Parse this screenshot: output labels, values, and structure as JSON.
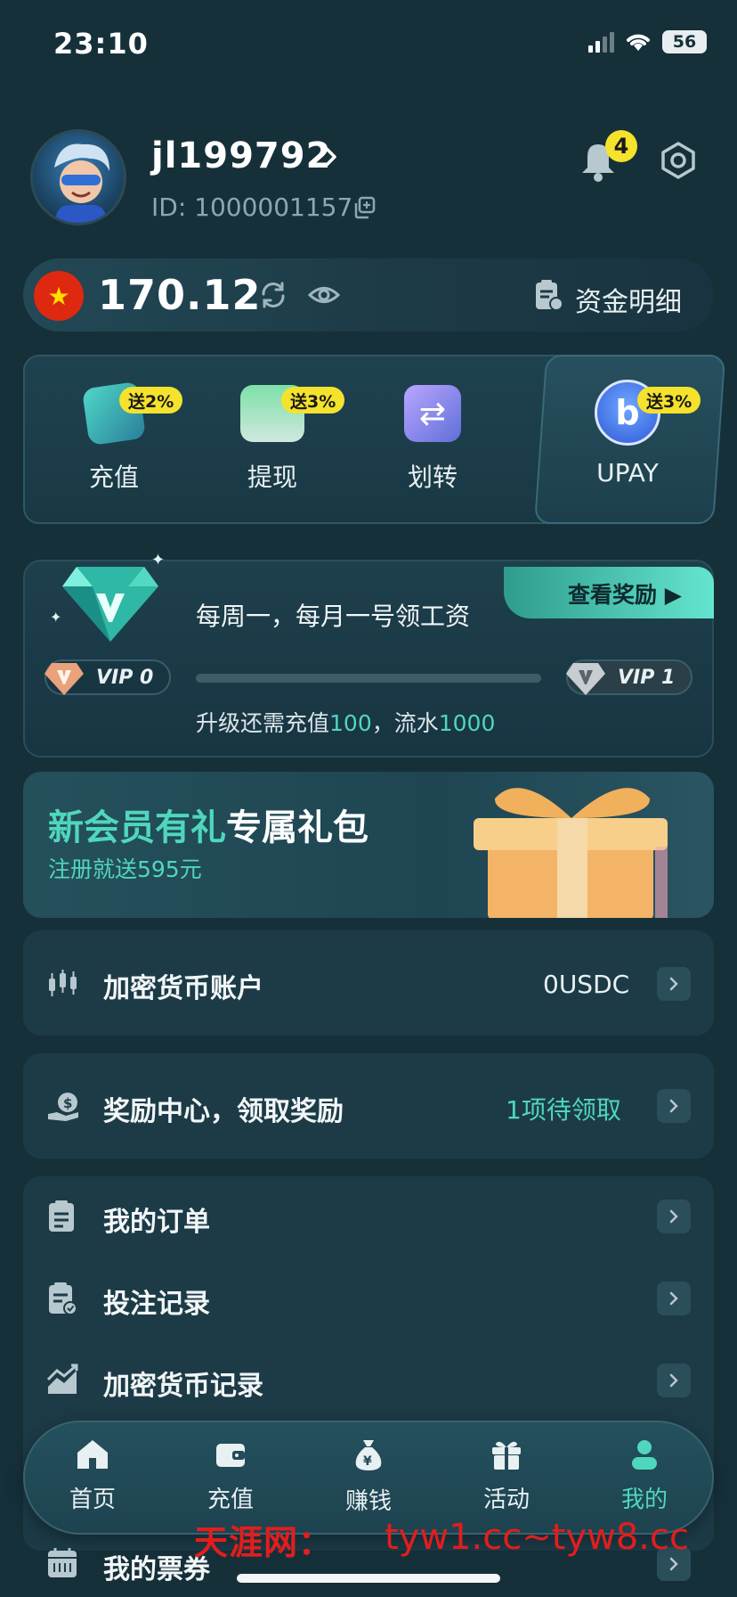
{
  "status_bar": {
    "time": "23:10",
    "battery": "56"
  },
  "profile": {
    "username": "jl199792",
    "id_text": "ID: 1000001157",
    "notification_count": "4"
  },
  "balance": {
    "amount": "170.12",
    "fund_details_label": "资金明细"
  },
  "quick_actions": [
    {
      "label": "充值",
      "tag": "送2%",
      "icon": "deposit-icon"
    },
    {
      "label": "提现",
      "tag": "送3%",
      "icon": "withdraw-icon"
    },
    {
      "label": "划转",
      "tag": "",
      "icon": "transfer-icon"
    },
    {
      "label": "UPAY",
      "tag": "送3%",
      "icon": "upay-icon"
    }
  ],
  "vip": {
    "view_rewards_label": "查看奖励",
    "headline": "每周一，每月一号领工资",
    "current_level": "VIP 0",
    "next_level": "VIP 1",
    "progress": 0,
    "note_prefix": "升级还需充值",
    "note_deposit": "100",
    "note_mid": "，流水",
    "note_turnover": "1000"
  },
  "new_member": {
    "title_highlight": "新会员有礼",
    "title_rest": "专属礼包",
    "subtitle": "注册就送595元"
  },
  "crypto_account": {
    "label": "加密货币账户",
    "value": "0USDC"
  },
  "reward_center": {
    "label": "奖励中心，领取奖励",
    "value": "1项待领取"
  },
  "menu": [
    {
      "label": "我的订单",
      "icon": "order-icon"
    },
    {
      "label": "投注记录",
      "icon": "bet-record-icon"
    },
    {
      "label": "加密货币记录",
      "icon": "crypto-record-icon"
    },
    {
      "label": "我的票券",
      "icon": "ticket-icon"
    }
  ],
  "nav": [
    {
      "label": "首页",
      "icon": "home-icon"
    },
    {
      "label": "充值",
      "icon": "wallet-icon"
    },
    {
      "label": "赚钱",
      "icon": "money-bag-icon"
    },
    {
      "label": "活动",
      "icon": "gift-icon"
    },
    {
      "label": "我的",
      "icon": "user-icon",
      "active": true
    }
  ],
  "watermark": {
    "text": "天涯网：",
    "url": "tyw1.cc~tyw8.cc"
  },
  "colors": {
    "accent": "#4fd7bd",
    "badge": "#f4e22c",
    "background": "#16303a"
  }
}
